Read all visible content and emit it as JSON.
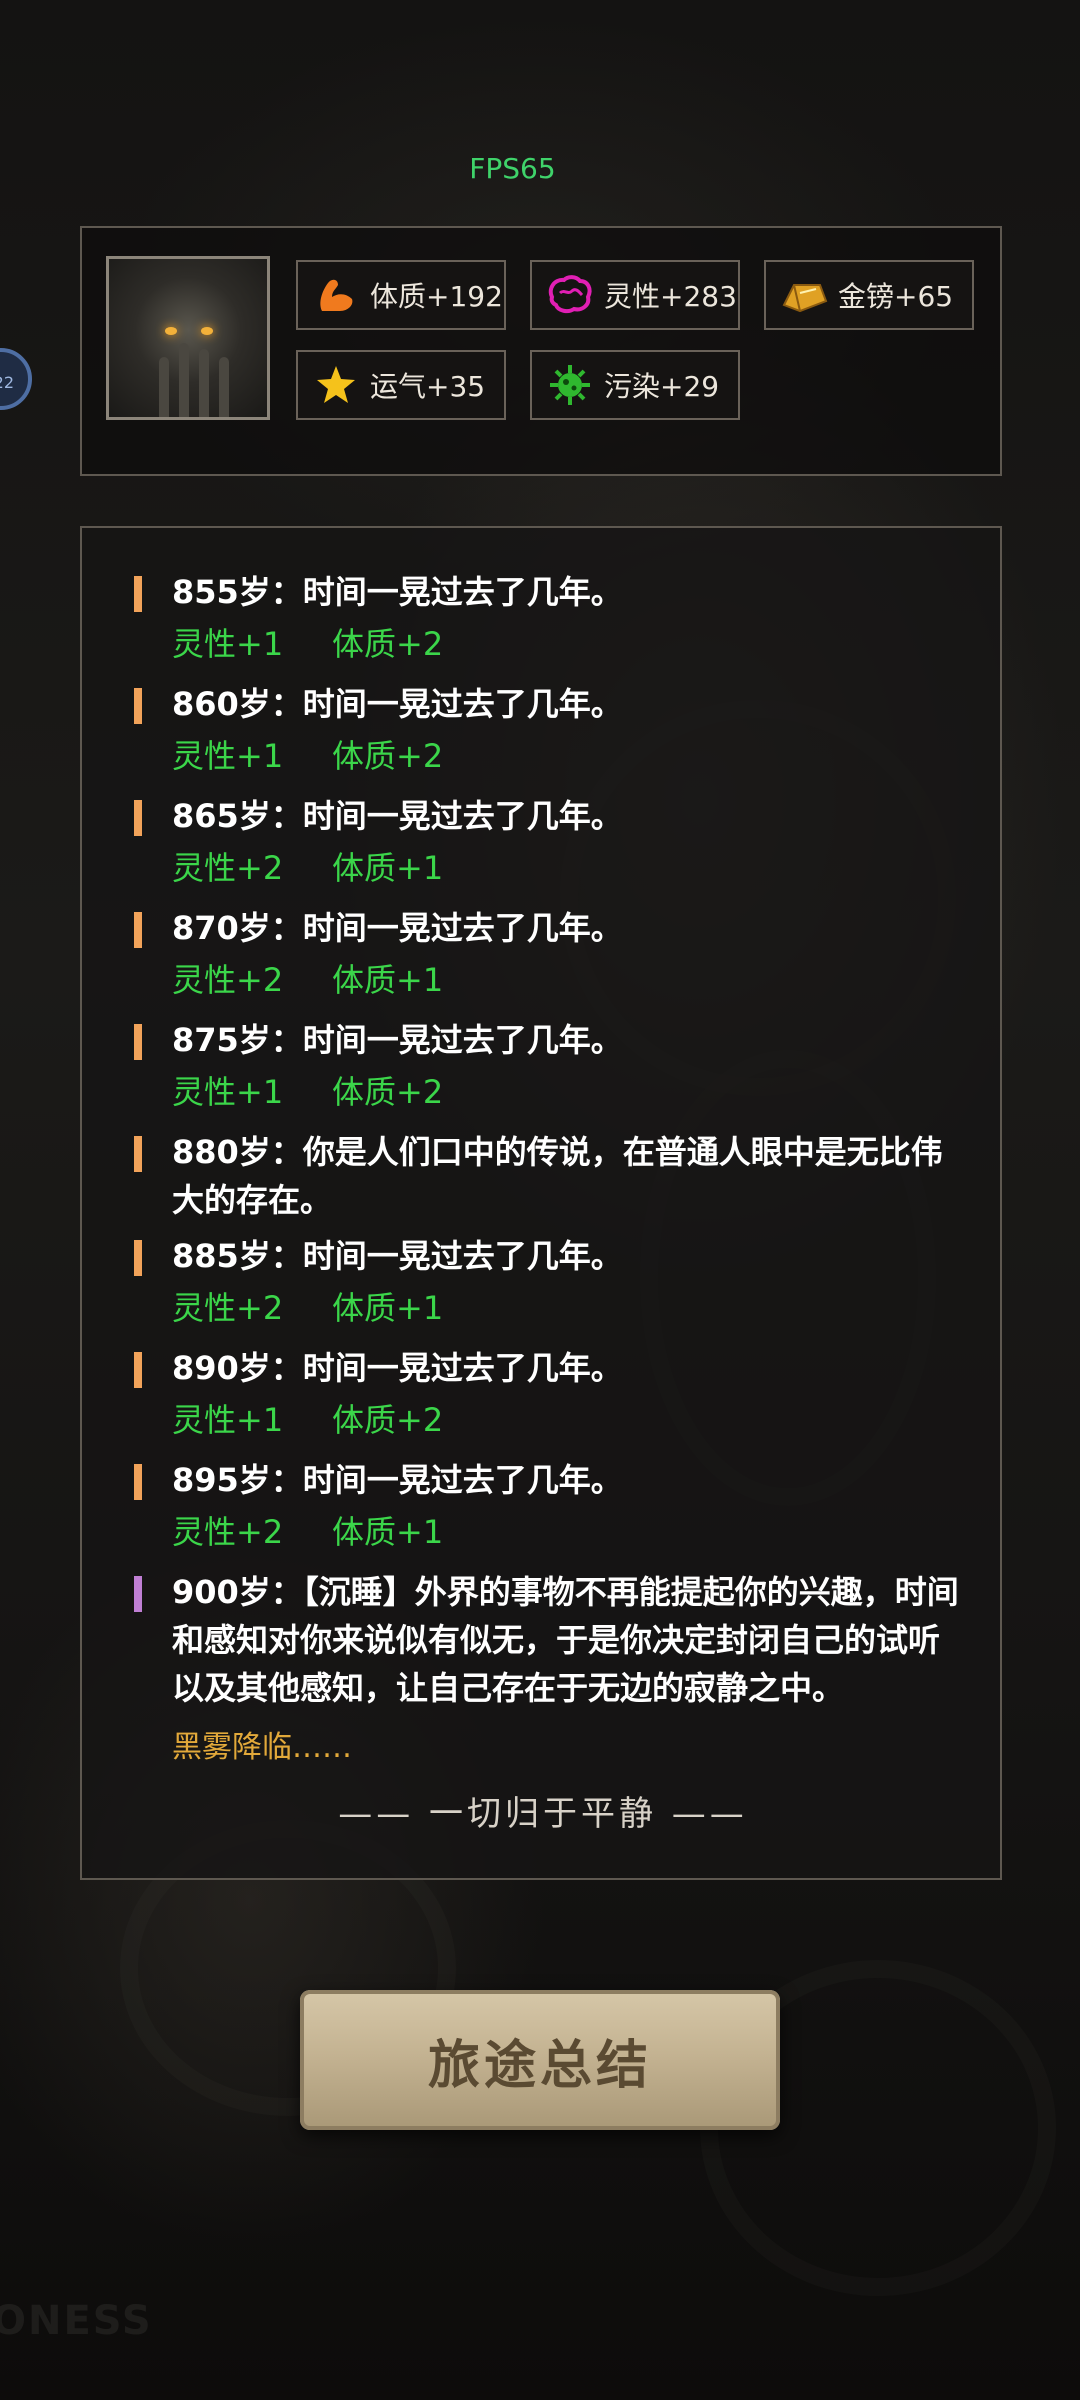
{
  "fps": "FPS65",
  "side_badge": "22",
  "stats": [
    {
      "icon": "muscle-icon",
      "label": "体质+192",
      "color": "#f07a1e"
    },
    {
      "icon": "brain-icon",
      "label": "灵性+283",
      "color": "#e11fb4"
    },
    {
      "icon": "gold-ingot-icon",
      "label": "金镑+65",
      "color": "#e0a124"
    },
    {
      "icon": "star-icon",
      "label": "运气+35",
      "color": "#f5c21b"
    },
    {
      "icon": "virus-icon",
      "label": "污染+29",
      "color": "#2fb82f"
    }
  ],
  "log": [
    {
      "text": "855岁：时间一晃过去了几年。",
      "g1": "灵性+1",
      "g2": "体质+2"
    },
    {
      "text": "860岁：时间一晃过去了几年。",
      "g1": "灵性+1",
      "g2": "体质+2"
    },
    {
      "text": "865岁：时间一晃过去了几年。",
      "g1": "灵性+2",
      "g2": "体质+1"
    },
    {
      "text": "870岁：时间一晃过去了几年。",
      "g1": "灵性+2",
      "g2": "体质+1"
    },
    {
      "text": "875岁：时间一晃过去了几年。",
      "g1": "灵性+1",
      "g2": "体质+2"
    },
    {
      "text": "880岁：你是人们口中的传说，在普通人眼中是无比伟大的存在。"
    },
    {
      "text": "885岁：时间一晃过去了几年。",
      "g1": "灵性+2",
      "g2": "体质+1"
    },
    {
      "text": "890岁：时间一晃过去了几年。",
      "g1": "灵性+1",
      "g2": "体质+2"
    },
    {
      "text": "895岁：时间一晃过去了几年。",
      "g1": "灵性+2",
      "g2": "体质+1"
    },
    {
      "text": "900岁：【沉睡】外界的事物不再能提起你的兴趣，时间和感知对你来说似有似无，于是你决定封闭自己的试听以及其他感知，让自己存在于无边的寂静之中。"
    }
  ],
  "black_fog": "黑雾降临……",
  "ending": "—— 一切归于平静 ——",
  "summary_button": "旅途总结",
  "watermark": "ONESS",
  "colors": {
    "gain": "#3bd64a",
    "bar_orange": "#f2a35a",
    "bar_purple": "#c07fd4",
    "fog": "#e2a93a",
    "fps": "#3fd36a"
  }
}
